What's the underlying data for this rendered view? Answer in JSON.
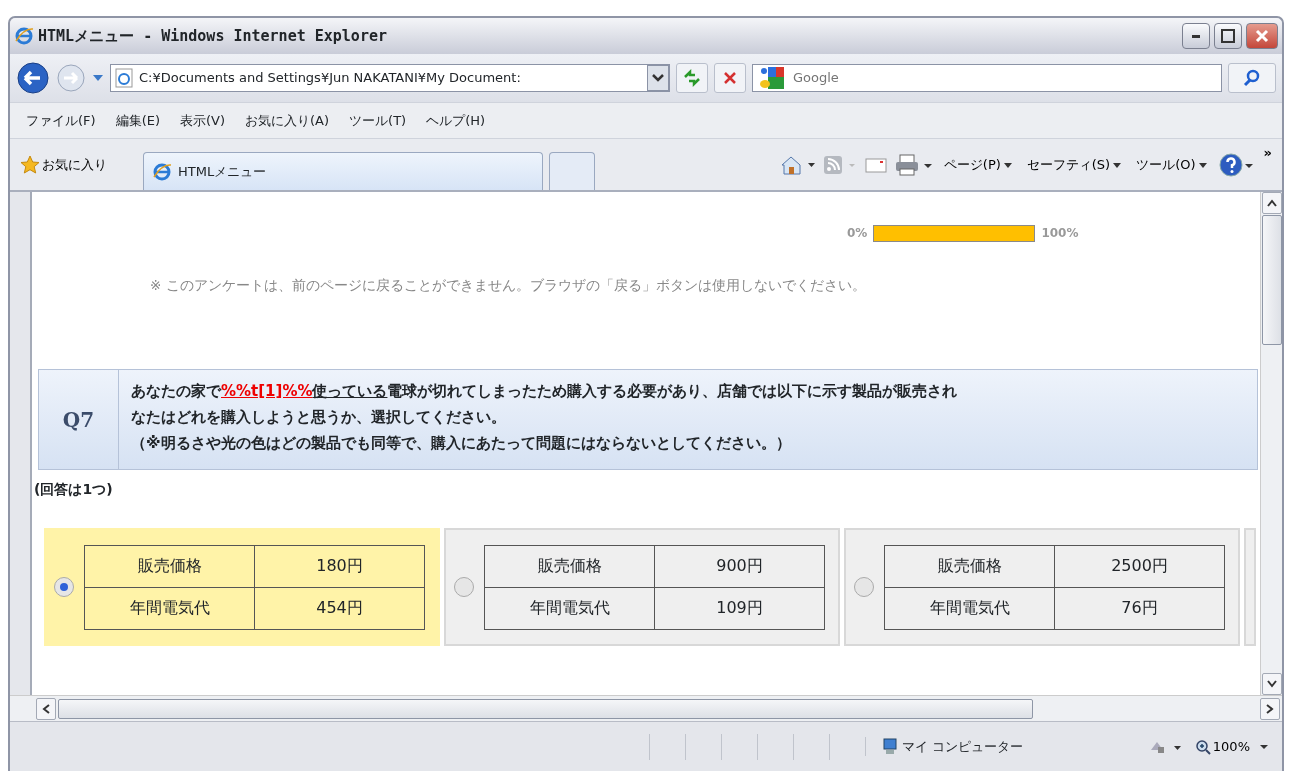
{
  "window": {
    "title": "HTMLメニュー - Windows Internet Explorer"
  },
  "address_bar": {
    "value": "C:¥Documents and Settings¥Jun NAKATANI¥My Document:"
  },
  "search": {
    "placeholder": "Google"
  },
  "menu": [
    "ファイル(F)",
    "編集(E)",
    "表示(V)",
    "お気に入り(A)",
    "ツール(T)",
    "ヘルプ(H)"
  ],
  "favorites": {
    "label": "お気に入り"
  },
  "tabs": [
    {
      "label": "HTMLメニュー",
      "selected": true
    }
  ],
  "command_bar": [
    "ページ(P)",
    "セーフティ(S)",
    "ツール(O)"
  ],
  "command_bar_more": "»",
  "progress": {
    "start": "0%",
    "end": "100%",
    "level": 1
  },
  "notice": "※ このアンケートは、前のページに戻ることができません。ブラウザの「戻る」ボタンは使用しないでください。",
  "question": {
    "number": "Q7",
    "lines": [
      [
        {
          "text": "あなたの家で"
        },
        {
          "text": "%%t[1]%%",
          "kind": "code"
        },
        {
          "text": "使っている",
          "kind": "underlined"
        },
        {
          "text": "電球が切れてしまったため購入する必要があり、店舗では以下に示す製品が販売され"
        }
      ],
      [
        {
          "text": "なたはどれを購入しようと思うか、選択してください。"
        }
      ],
      [
        {
          "text": "（※明るさや光の色はどの製品でも同等で、購入にあたって問題にはならないとしてください。）"
        }
      ]
    ]
  },
  "answer_note": "(回答は1つ)",
  "options": [
    {
      "selected": true,
      "price_label": "販売価格",
      "price": "180円",
      "cost_label": "年間電気代",
      "cost": "454円"
    },
    {
      "selected": false,
      "price_label": "販売価格",
      "price": "900円",
      "cost_label": "年間電気代",
      "cost": "109円"
    },
    {
      "selected": false,
      "price_label": "販売価格",
      "price": "2500円",
      "cost_label": "年間電気代",
      "cost": "76円"
    }
  ],
  "status_bar": {
    "zone": "マイ コンピューター",
    "zoom": "100%"
  }
}
